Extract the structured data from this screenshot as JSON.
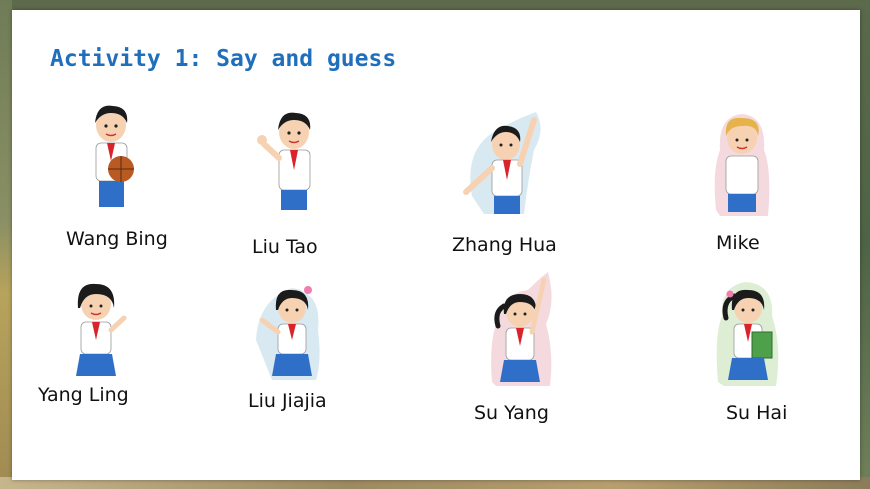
{
  "slide": {
    "title": "Activity 1: Say and guess"
  },
  "characters": [
    {
      "name": "Wang Bing",
      "hair": "short",
      "gender": "boy",
      "outline": "#ffffff",
      "prop": "basketball"
    },
    {
      "name": "Liu Tao",
      "hair": "short",
      "gender": "boy",
      "outline": "#ffffff",
      "prop": "wave"
    },
    {
      "name": "Zhang Hua",
      "hair": "short",
      "gender": "boy",
      "outline": "#cfe3ef",
      "prop": "raise-hand"
    },
    {
      "name": "Mike",
      "hair": "blond",
      "gender": "boy",
      "outline": "#f2d3d8",
      "prop": "none"
    },
    {
      "name": "Yang Ling",
      "hair": "bob",
      "gender": "girl",
      "outline": "#ffffff",
      "prop": "wave"
    },
    {
      "name": "Liu Jiajia",
      "hair": "pigtail",
      "gender": "girl",
      "outline": "#cfe3ef",
      "prop": "wave"
    },
    {
      "name": "Su Yang",
      "hair": "ponytail",
      "gender": "girl",
      "outline": "#f2d3d8",
      "prop": "raise-hand"
    },
    {
      "name": "Su Hai",
      "hair": "ponytail",
      "gender": "girl",
      "outline": "#d9ecd0",
      "prop": "book"
    }
  ],
  "colors": {
    "title": "#1f6fbd",
    "shirt": "#ffffff",
    "scarf": "#d8242b",
    "trousers": "#2f6fc7",
    "skin": "#f6d2b3",
    "hair_dark": "#1b1b1b",
    "hair_blond": "#e6b24a"
  }
}
